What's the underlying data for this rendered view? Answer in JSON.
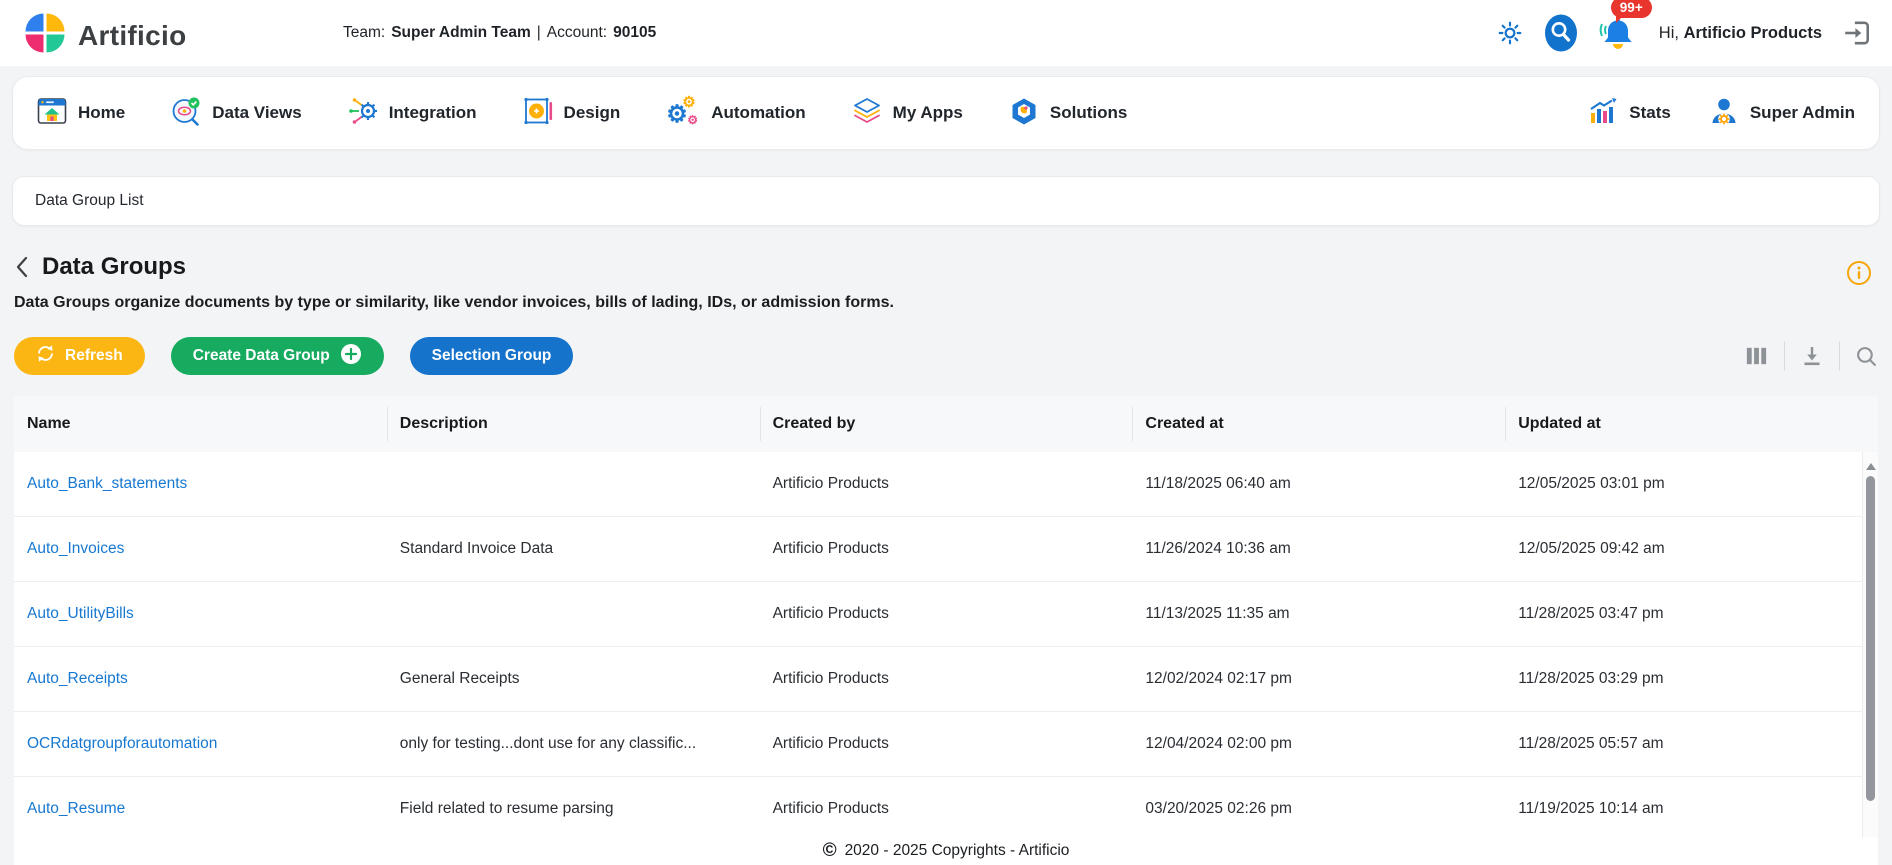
{
  "header": {
    "brand": "Artificio",
    "team_label": "Team:",
    "team_value": "Super Admin Team",
    "separator": "|",
    "account_label": "Account:",
    "account_value": "90105",
    "notification_badge": "99+",
    "greeting_prefix": "Hi,",
    "greeting_name": "Artificio Products"
  },
  "nav": {
    "items": [
      {
        "label": "Home",
        "icon": "home-icon"
      },
      {
        "label": "Data Views",
        "icon": "data-views-icon"
      },
      {
        "label": "Integration",
        "icon": "integration-icon"
      },
      {
        "label": "Design",
        "icon": "design-icon"
      },
      {
        "label": "Automation",
        "icon": "automation-icon"
      },
      {
        "label": "My Apps",
        "icon": "my-apps-icon"
      },
      {
        "label": "Solutions",
        "icon": "solutions-icon"
      }
    ],
    "right_items": [
      {
        "label": "Stats",
        "icon": "stats-icon"
      },
      {
        "label": "Super Admin",
        "icon": "super-admin-icon"
      }
    ]
  },
  "breadcrumb": {
    "label": "Data Group List"
  },
  "page": {
    "title": "Data Groups",
    "description": "Data Groups organize documents by type or similarity, like vendor invoices, bills of lading, IDs, or admission forms."
  },
  "toolbar": {
    "refresh_label": "Refresh",
    "create_label": "Create Data Group",
    "selection_label": "Selection Group"
  },
  "table": {
    "columns": [
      "Name",
      "Description",
      "Created by",
      "Created at",
      "Updated at"
    ],
    "rows": [
      {
        "name": "Auto_Bank_statements",
        "description": "",
        "created_by": "Artificio Products",
        "created_at": "11/18/2025 06:40 am",
        "updated_at": "12/05/2025 03:01 pm"
      },
      {
        "name": "Auto_Invoices",
        "description": "Standard Invoice Data",
        "created_by": "Artificio Products",
        "created_at": "11/26/2024 10:36 am",
        "updated_at": "12/05/2025 09:42 am"
      },
      {
        "name": "Auto_UtilityBills",
        "description": "",
        "created_by": "Artificio Products",
        "created_at": "11/13/2025 11:35 am",
        "updated_at": "11/28/2025 03:47 pm"
      },
      {
        "name": "Auto_Receipts",
        "description": "General Receipts",
        "created_by": "Artificio Products",
        "created_at": "12/02/2024 02:17 pm",
        "updated_at": "11/28/2025 03:29 pm"
      },
      {
        "name": "OCRdatgroupforautomation",
        "description": "only for testing...dont use for any classific...",
        "created_by": "Artificio Products",
        "created_at": "12/04/2024 02:00 pm",
        "updated_at": "11/28/2025 05:57 am"
      },
      {
        "name": "Auto_Resume",
        "description": "Field related to resume parsing",
        "created_by": "Artificio Products",
        "created_at": "03/20/2025 02:26 pm",
        "updated_at": "11/19/2025 10:14 am"
      }
    ]
  },
  "footer": {
    "symbol": "©",
    "text": "2020 - 2025 Copyrights - Artificio"
  },
  "colors": {
    "refresh_button": "#fcb614",
    "create_button": "#17ab60",
    "selection_button": "#1573cb",
    "link_blue": "#1778d1",
    "badge_red": "#e8352e",
    "info_amber": "#f6a50b",
    "accent_blue": "#1273cc"
  }
}
